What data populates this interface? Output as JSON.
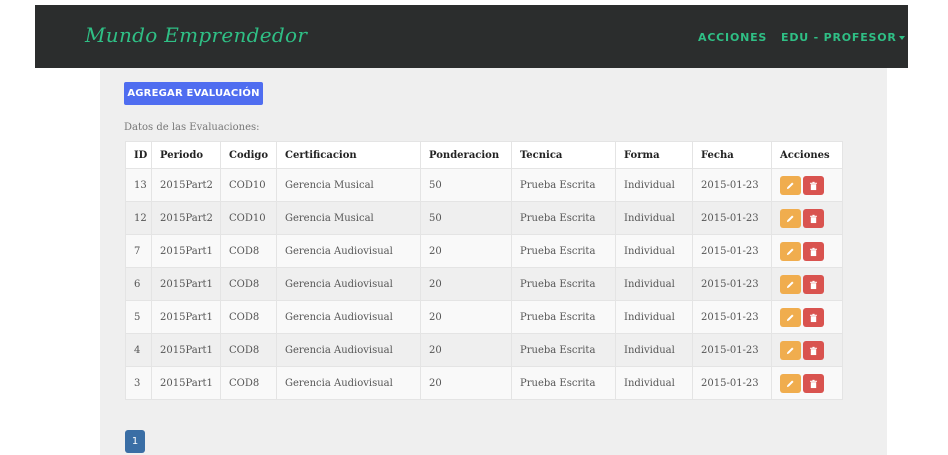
{
  "navbar": {
    "brand": "Mundo Emprendedor",
    "acciones": "ACCIONES",
    "user": "EDU - PROFESOR"
  },
  "main": {
    "add_button": "AGREGAR EVALUACIÓN",
    "table_caption": "Datos de las Evaluaciones:",
    "columns": [
      "ID",
      "Periodo",
      "Codigo",
      "Certificacion",
      "Ponderacion",
      "Tecnica",
      "Forma",
      "Fecha",
      "Acciones"
    ],
    "rows": [
      {
        "id": "13",
        "periodo": "2015Part2",
        "codigo": "COD10",
        "certificacion": "Gerencia Musical",
        "ponderacion": "50",
        "tecnica": "Prueba Escrita",
        "forma": "Individual",
        "fecha": "2015-01-23"
      },
      {
        "id": "12",
        "periodo": "2015Part2",
        "codigo": "COD10",
        "certificacion": "Gerencia Musical",
        "ponderacion": "50",
        "tecnica": "Prueba Escrita",
        "forma": "Individual",
        "fecha": "2015-01-23"
      },
      {
        "id": "7",
        "periodo": "2015Part1",
        "codigo": "COD8",
        "certificacion": "Gerencia Audiovisual",
        "ponderacion": "20",
        "tecnica": "Prueba Escrita",
        "forma": "Individual",
        "fecha": "2015-01-23"
      },
      {
        "id": "6",
        "periodo": "2015Part1",
        "codigo": "COD8",
        "certificacion": "Gerencia Audiovisual",
        "ponderacion": "20",
        "tecnica": "Prueba Escrita",
        "forma": "Individual",
        "fecha": "2015-01-23"
      },
      {
        "id": "5",
        "periodo": "2015Part1",
        "codigo": "COD8",
        "certificacion": "Gerencia Audiovisual",
        "ponderacion": "20",
        "tecnica": "Prueba Escrita",
        "forma": "Individual",
        "fecha": "2015-01-23"
      },
      {
        "id": "4",
        "periodo": "2015Part1",
        "codigo": "COD8",
        "certificacion": "Gerencia Audiovisual",
        "ponderacion": "20",
        "tecnica": "Prueba Escrita",
        "forma": "Individual",
        "fecha": "2015-01-23"
      },
      {
        "id": "3",
        "periodo": "2015Part1",
        "codigo": "COD8",
        "certificacion": "Gerencia Audiovisual",
        "ponderacion": "20",
        "tecnica": "Prueba Escrita",
        "forma": "Individual",
        "fecha": "2015-01-23"
      }
    ],
    "row_actions": [
      "pencil-icon",
      "trash-icon"
    ]
  },
  "pagination": {
    "current_page": "1"
  },
  "colors": {
    "navbar_bg": "#2b2d2d",
    "brand_green": "#2fbf85",
    "primary_button": "#4f6df0",
    "edit_button": "#f0ad4e",
    "delete_button": "#d9534f",
    "page_button": "#3a6ea5",
    "content_bg": "#efefef"
  }
}
